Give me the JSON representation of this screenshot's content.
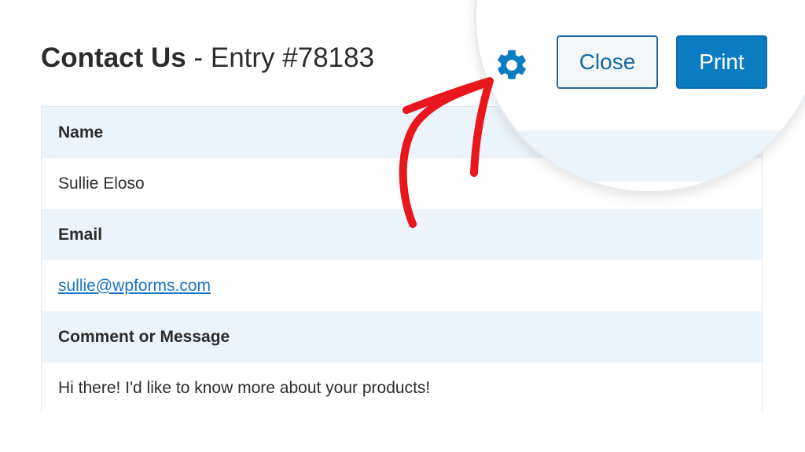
{
  "header": {
    "form_name": "Contact Us",
    "separator": " - ",
    "entry_label": "Entry #78183"
  },
  "actions": {
    "settings_icon": "gear-icon",
    "close_label": "Close",
    "print_label": "Print"
  },
  "entry": {
    "fields": [
      {
        "label": "Name",
        "value": "Sullie Eloso"
      },
      {
        "label": "Email",
        "value": "sullie@wpforms.com"
      },
      {
        "label": "Comment or Message",
        "value": "Hi there! I'd like to know more about your products!"
      }
    ]
  },
  "annotation": {
    "arrow_color": "#e8171d"
  },
  "colors": {
    "accent": "#0b7cc1",
    "label_row_bg": "#ebf3fb",
    "link": "#1a73c4"
  }
}
